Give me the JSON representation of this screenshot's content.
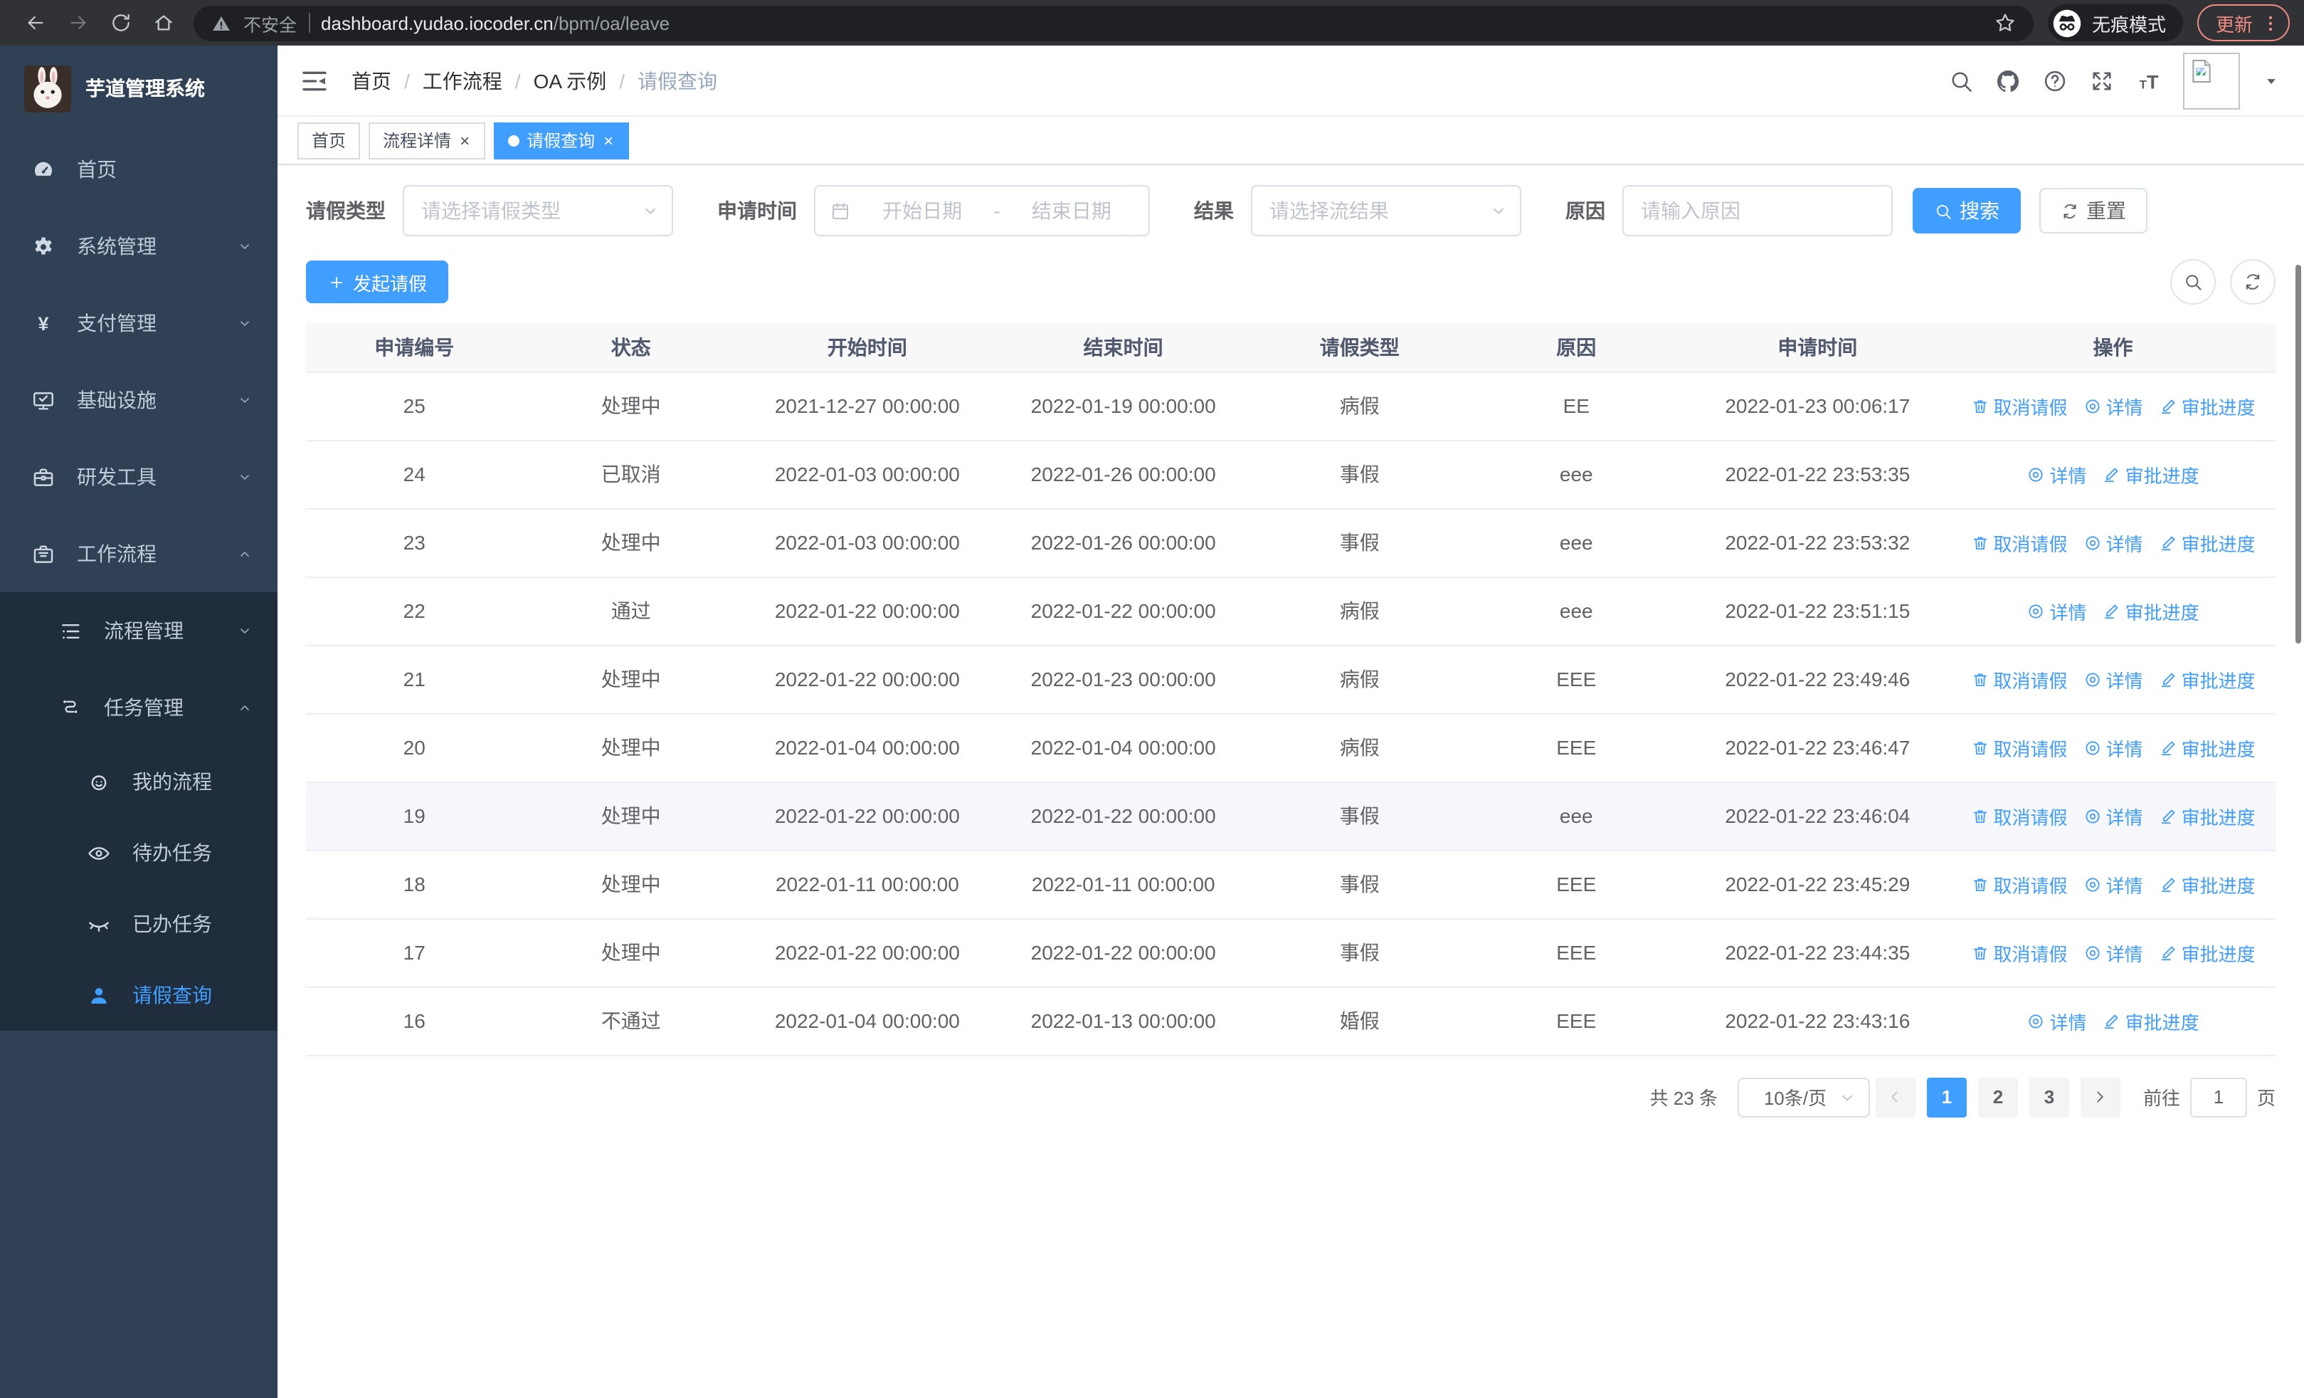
{
  "browser": {
    "security_label": "不安全",
    "url_host": "dashboard.yudao.iocoder.cn",
    "url_path": "/bpm/oa/leave",
    "incognito_label": "无痕模式",
    "update_label": "更新"
  },
  "sidebar": {
    "logo_title": "芋道管理系统",
    "menu": [
      {
        "key": "home",
        "icon": "dashboard-icon",
        "label": "首页"
      },
      {
        "key": "system",
        "icon": "gear-icon",
        "label": "系统管理",
        "arrow": "down"
      },
      {
        "key": "payment",
        "icon": "yen-icon",
        "label": "支付管理",
        "arrow": "down"
      },
      {
        "key": "infrastructure",
        "icon": "monitor-icon",
        "label": "基础设施",
        "arrow": "down"
      },
      {
        "key": "dev-tools",
        "icon": "toolbox-icon",
        "label": "研发工具",
        "arrow": "down"
      },
      {
        "key": "workflow",
        "icon": "briefcase-icon",
        "label": "工作流程",
        "arrow": "up",
        "children": [
          {
            "key": "process-mgmt",
            "icon": "list-icon",
            "label": "流程管理",
            "arrow": "down"
          },
          {
            "key": "task-mgmt",
            "icon": "flow-icon",
            "label": "任务管理",
            "arrow": "up",
            "children": [
              {
                "key": "my-process",
                "icon": "robot-icon",
                "label": "我的流程"
              },
              {
                "key": "todo-tasks",
                "icon": "eye-open-icon",
                "label": "待办任务"
              },
              {
                "key": "done-tasks",
                "icon": "eye-closed-icon",
                "label": "已办任务"
              },
              {
                "key": "leave-query",
                "icon": "user-icon",
                "label": "请假查询",
                "active": true
              }
            ]
          }
        ]
      }
    ]
  },
  "breadcrumb": {
    "items": [
      "首页",
      "工作流程",
      "OA 示例",
      "请假查询"
    ]
  },
  "tabs": [
    {
      "label": "首页",
      "closable": false,
      "active": false
    },
    {
      "label": "流程详情",
      "closable": true,
      "active": false
    },
    {
      "label": "请假查询",
      "closable": true,
      "active": true
    }
  ],
  "filters": {
    "leave_type_label": "请假类型",
    "leave_type_placeholder": "请选择请假类型",
    "apply_time_label": "申请时间",
    "date_start_placeholder": "开始日期",
    "date_separator": "-",
    "date_end_placeholder": "结束日期",
    "result_label": "结果",
    "result_placeholder": "请选择流结果",
    "reason_label": "原因",
    "reason_placeholder": "请输入原因",
    "search_label": "搜索",
    "reset_label": "重置"
  },
  "toolbar": {
    "create_label": "发起请假"
  },
  "table": {
    "headers": [
      "申请编号",
      "状态",
      "开始时间",
      "结束时间",
      "请假类型",
      "原因",
      "申请时间",
      "操作"
    ],
    "action_labels": {
      "cancel": "取消请假",
      "detail": "详情",
      "progress": "审批进度"
    },
    "rows": [
      {
        "id": "25",
        "status": "处理中",
        "start_time": "2021-12-27 00:00:00",
        "end_time": "2022-01-19 00:00:00",
        "leave_type": "病假",
        "reason": "EE",
        "apply_time": "2022-01-23 00:06:17",
        "actions": [
          "cancel",
          "detail",
          "progress"
        ]
      },
      {
        "id": "24",
        "status": "已取消",
        "start_time": "2022-01-03 00:00:00",
        "end_time": "2022-01-26 00:00:00",
        "leave_type": "事假",
        "reason": "eee",
        "apply_time": "2022-01-22 23:53:35",
        "actions": [
          "detail",
          "progress"
        ]
      },
      {
        "id": "23",
        "status": "处理中",
        "start_time": "2022-01-03 00:00:00",
        "end_time": "2022-01-26 00:00:00",
        "leave_type": "事假",
        "reason": "eee",
        "apply_time": "2022-01-22 23:53:32",
        "actions": [
          "cancel",
          "detail",
          "progress"
        ]
      },
      {
        "id": "22",
        "status": "通过",
        "start_time": "2022-01-22 00:00:00",
        "end_time": "2022-01-22 00:00:00",
        "leave_type": "病假",
        "reason": "eee",
        "apply_time": "2022-01-22 23:51:15",
        "actions": [
          "detail",
          "progress"
        ]
      },
      {
        "id": "21",
        "status": "处理中",
        "start_time": "2022-01-22 00:00:00",
        "end_time": "2022-01-23 00:00:00",
        "leave_type": "病假",
        "reason": "EEE",
        "apply_time": "2022-01-22 23:49:46",
        "actions": [
          "cancel",
          "detail",
          "progress"
        ]
      },
      {
        "id": "20",
        "status": "处理中",
        "start_time": "2022-01-04 00:00:00",
        "end_time": "2022-01-04 00:00:00",
        "leave_type": "病假",
        "reason": "EEE",
        "apply_time": "2022-01-22 23:46:47",
        "actions": [
          "cancel",
          "detail",
          "progress"
        ]
      },
      {
        "id": "19",
        "status": "处理中",
        "start_time": "2022-01-22 00:00:00",
        "end_time": "2022-01-22 00:00:00",
        "leave_type": "事假",
        "reason": "eee",
        "apply_time": "2022-01-22 23:46:04",
        "actions": [
          "cancel",
          "detail",
          "progress"
        ],
        "highlighted": true
      },
      {
        "id": "18",
        "status": "处理中",
        "start_time": "2022-01-11 00:00:00",
        "end_time": "2022-01-11 00:00:00",
        "leave_type": "事假",
        "reason": "EEE",
        "apply_time": "2022-01-22 23:45:29",
        "actions": [
          "cancel",
          "detail",
          "progress"
        ]
      },
      {
        "id": "17",
        "status": "处理中",
        "start_time": "2022-01-22 00:00:00",
        "end_time": "2022-01-22 00:00:00",
        "leave_type": "事假",
        "reason": "EEE",
        "apply_time": "2022-01-22 23:44:35",
        "actions": [
          "cancel",
          "detail",
          "progress"
        ]
      },
      {
        "id": "16",
        "status": "不通过",
        "start_time": "2022-01-04 00:00:00",
        "end_time": "2022-01-13 00:00:00",
        "leave_type": "婚假",
        "reason": "EEE",
        "apply_time": "2022-01-22 23:43:16",
        "actions": [
          "detail",
          "progress"
        ]
      }
    ]
  },
  "pagination": {
    "total_label": "共 23 条",
    "page_size_label": "10条/页",
    "pages": [
      "1",
      "2",
      "3"
    ],
    "active_page": "1",
    "goto_label": "前往",
    "goto_value": "1",
    "page_unit_label": "页"
  },
  "colors": {
    "accent": "#409eff",
    "sidebar_bg": "#304156",
    "submenu_bg": "#1f2d3d"
  }
}
